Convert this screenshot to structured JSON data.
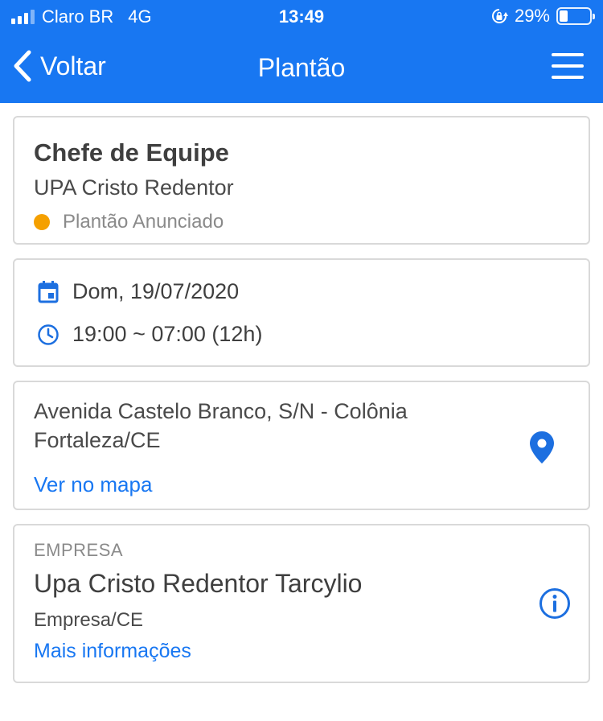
{
  "status_bar": {
    "carrier": "Claro BR",
    "network": "4G",
    "time": "13:49",
    "battery": "29%",
    "battery_level": 0.29
  },
  "nav": {
    "back_label": "Voltar",
    "title": "Plantão"
  },
  "shift": {
    "role": "Chefe de Equipe",
    "place": "UPA Cristo Redentor",
    "status": "Plantão Anunciado",
    "status_color": "#f5a000"
  },
  "schedule": {
    "date": "Dom, 19/07/2020",
    "time": "19:00 ~ 07:00 (12h)"
  },
  "address": {
    "line1": "Avenida Castelo Branco, S/N - Colônia",
    "line2": "Fortaleza/CE",
    "map_link": "Ver no mapa"
  },
  "company": {
    "label": "EMPRESA",
    "name": "Upa Cristo Redentor Tarcylio",
    "sub": "Empresa/CE",
    "more_link": "Mais informações"
  },
  "colors": {
    "accent": "#1877f2",
    "icon_blue": "#1c6fe0"
  },
  "icons": [
    "signal-icon",
    "orientation-lock-icon",
    "battery-icon",
    "chevron-left-icon",
    "menu-icon",
    "calendar-icon",
    "clock-icon",
    "map-pin-icon",
    "info-icon"
  ]
}
